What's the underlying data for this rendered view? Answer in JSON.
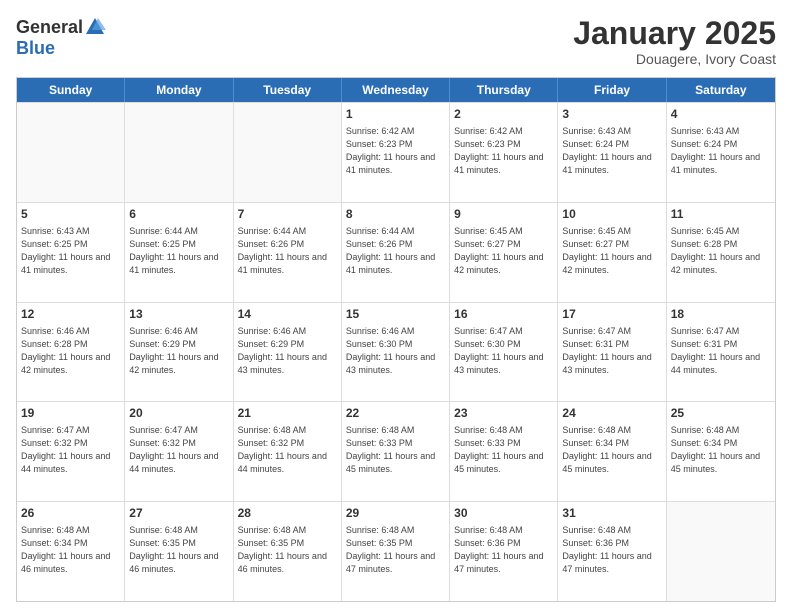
{
  "header": {
    "logo_general": "General",
    "logo_blue": "Blue",
    "title": "January 2025",
    "subtitle": "Douagere, Ivory Coast"
  },
  "days_of_week": [
    "Sunday",
    "Monday",
    "Tuesday",
    "Wednesday",
    "Thursday",
    "Friday",
    "Saturday"
  ],
  "weeks": [
    [
      {
        "day": "",
        "sunrise": "",
        "sunset": "",
        "daylight": "",
        "empty": true
      },
      {
        "day": "",
        "sunrise": "",
        "sunset": "",
        "daylight": "",
        "empty": true
      },
      {
        "day": "",
        "sunrise": "",
        "sunset": "",
        "daylight": "",
        "empty": true
      },
      {
        "day": "1",
        "sunrise": "Sunrise: 6:42 AM",
        "sunset": "Sunset: 6:23 PM",
        "daylight": "Daylight: 11 hours and 41 minutes."
      },
      {
        "day": "2",
        "sunrise": "Sunrise: 6:42 AM",
        "sunset": "Sunset: 6:23 PM",
        "daylight": "Daylight: 11 hours and 41 minutes."
      },
      {
        "day": "3",
        "sunrise": "Sunrise: 6:43 AM",
        "sunset": "Sunset: 6:24 PM",
        "daylight": "Daylight: 11 hours and 41 minutes."
      },
      {
        "day": "4",
        "sunrise": "Sunrise: 6:43 AM",
        "sunset": "Sunset: 6:24 PM",
        "daylight": "Daylight: 11 hours and 41 minutes."
      }
    ],
    [
      {
        "day": "5",
        "sunrise": "Sunrise: 6:43 AM",
        "sunset": "Sunset: 6:25 PM",
        "daylight": "Daylight: 11 hours and 41 minutes."
      },
      {
        "day": "6",
        "sunrise": "Sunrise: 6:44 AM",
        "sunset": "Sunset: 6:25 PM",
        "daylight": "Daylight: 11 hours and 41 minutes."
      },
      {
        "day": "7",
        "sunrise": "Sunrise: 6:44 AM",
        "sunset": "Sunset: 6:26 PM",
        "daylight": "Daylight: 11 hours and 41 minutes."
      },
      {
        "day": "8",
        "sunrise": "Sunrise: 6:44 AM",
        "sunset": "Sunset: 6:26 PM",
        "daylight": "Daylight: 11 hours and 41 minutes."
      },
      {
        "day": "9",
        "sunrise": "Sunrise: 6:45 AM",
        "sunset": "Sunset: 6:27 PM",
        "daylight": "Daylight: 11 hours and 42 minutes."
      },
      {
        "day": "10",
        "sunrise": "Sunrise: 6:45 AM",
        "sunset": "Sunset: 6:27 PM",
        "daylight": "Daylight: 11 hours and 42 minutes."
      },
      {
        "day": "11",
        "sunrise": "Sunrise: 6:45 AM",
        "sunset": "Sunset: 6:28 PM",
        "daylight": "Daylight: 11 hours and 42 minutes."
      }
    ],
    [
      {
        "day": "12",
        "sunrise": "Sunrise: 6:46 AM",
        "sunset": "Sunset: 6:28 PM",
        "daylight": "Daylight: 11 hours and 42 minutes."
      },
      {
        "day": "13",
        "sunrise": "Sunrise: 6:46 AM",
        "sunset": "Sunset: 6:29 PM",
        "daylight": "Daylight: 11 hours and 42 minutes."
      },
      {
        "day": "14",
        "sunrise": "Sunrise: 6:46 AM",
        "sunset": "Sunset: 6:29 PM",
        "daylight": "Daylight: 11 hours and 43 minutes."
      },
      {
        "day": "15",
        "sunrise": "Sunrise: 6:46 AM",
        "sunset": "Sunset: 6:30 PM",
        "daylight": "Daylight: 11 hours and 43 minutes."
      },
      {
        "day": "16",
        "sunrise": "Sunrise: 6:47 AM",
        "sunset": "Sunset: 6:30 PM",
        "daylight": "Daylight: 11 hours and 43 minutes."
      },
      {
        "day": "17",
        "sunrise": "Sunrise: 6:47 AM",
        "sunset": "Sunset: 6:31 PM",
        "daylight": "Daylight: 11 hours and 43 minutes."
      },
      {
        "day": "18",
        "sunrise": "Sunrise: 6:47 AM",
        "sunset": "Sunset: 6:31 PM",
        "daylight": "Daylight: 11 hours and 44 minutes."
      }
    ],
    [
      {
        "day": "19",
        "sunrise": "Sunrise: 6:47 AM",
        "sunset": "Sunset: 6:32 PM",
        "daylight": "Daylight: 11 hours and 44 minutes."
      },
      {
        "day": "20",
        "sunrise": "Sunrise: 6:47 AM",
        "sunset": "Sunset: 6:32 PM",
        "daylight": "Daylight: 11 hours and 44 minutes."
      },
      {
        "day": "21",
        "sunrise": "Sunrise: 6:48 AM",
        "sunset": "Sunset: 6:32 PM",
        "daylight": "Daylight: 11 hours and 44 minutes."
      },
      {
        "day": "22",
        "sunrise": "Sunrise: 6:48 AM",
        "sunset": "Sunset: 6:33 PM",
        "daylight": "Daylight: 11 hours and 45 minutes."
      },
      {
        "day": "23",
        "sunrise": "Sunrise: 6:48 AM",
        "sunset": "Sunset: 6:33 PM",
        "daylight": "Daylight: 11 hours and 45 minutes."
      },
      {
        "day": "24",
        "sunrise": "Sunrise: 6:48 AM",
        "sunset": "Sunset: 6:34 PM",
        "daylight": "Daylight: 11 hours and 45 minutes."
      },
      {
        "day": "25",
        "sunrise": "Sunrise: 6:48 AM",
        "sunset": "Sunset: 6:34 PM",
        "daylight": "Daylight: 11 hours and 45 minutes."
      }
    ],
    [
      {
        "day": "26",
        "sunrise": "Sunrise: 6:48 AM",
        "sunset": "Sunset: 6:34 PM",
        "daylight": "Daylight: 11 hours and 46 minutes."
      },
      {
        "day": "27",
        "sunrise": "Sunrise: 6:48 AM",
        "sunset": "Sunset: 6:35 PM",
        "daylight": "Daylight: 11 hours and 46 minutes."
      },
      {
        "day": "28",
        "sunrise": "Sunrise: 6:48 AM",
        "sunset": "Sunset: 6:35 PM",
        "daylight": "Daylight: 11 hours and 46 minutes."
      },
      {
        "day": "29",
        "sunrise": "Sunrise: 6:48 AM",
        "sunset": "Sunset: 6:35 PM",
        "daylight": "Daylight: 11 hours and 47 minutes."
      },
      {
        "day": "30",
        "sunrise": "Sunrise: 6:48 AM",
        "sunset": "Sunset: 6:36 PM",
        "daylight": "Daylight: 11 hours and 47 minutes."
      },
      {
        "day": "31",
        "sunrise": "Sunrise: 6:48 AM",
        "sunset": "Sunset: 6:36 PM",
        "daylight": "Daylight: 11 hours and 47 minutes."
      },
      {
        "day": "",
        "sunrise": "",
        "sunset": "",
        "daylight": "",
        "empty": true
      }
    ]
  ]
}
